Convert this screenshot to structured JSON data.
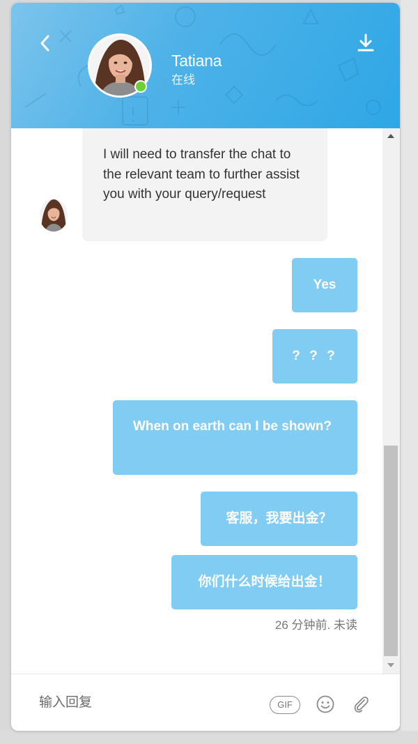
{
  "header": {
    "agent_name": "Tatiana",
    "agent_status": "在线",
    "back_icon": "chevron-left-icon",
    "download_icon": "download-icon",
    "online_color": "#6ad135",
    "gradient_colors": [
      "#7cc4ec",
      "#2ea7e6"
    ]
  },
  "messages": [
    {
      "from": "agent",
      "text": "I will need to transfer the chat to the relevant team to further assist you with your query/request"
    },
    {
      "from": "user",
      "text": "Yes"
    },
    {
      "from": "user",
      "text": "? ? ?"
    },
    {
      "from": "user",
      "text": "When on earth can I be shown?"
    },
    {
      "from": "user",
      "text": "客服，我要出金？"
    },
    {
      "from": "user",
      "text": "你们什么时候给出金！"
    }
  ],
  "meta": {
    "last_message_info": "26 分钟前. 未读"
  },
  "composer": {
    "placeholder": "输入回复",
    "gif_label": "GIF",
    "emoji_icon": "smiley-icon",
    "attach_icon": "paperclip-icon"
  },
  "colors": {
    "user_bubble": "#80ccf2",
    "agent_bubble": "#f3f3f3"
  }
}
